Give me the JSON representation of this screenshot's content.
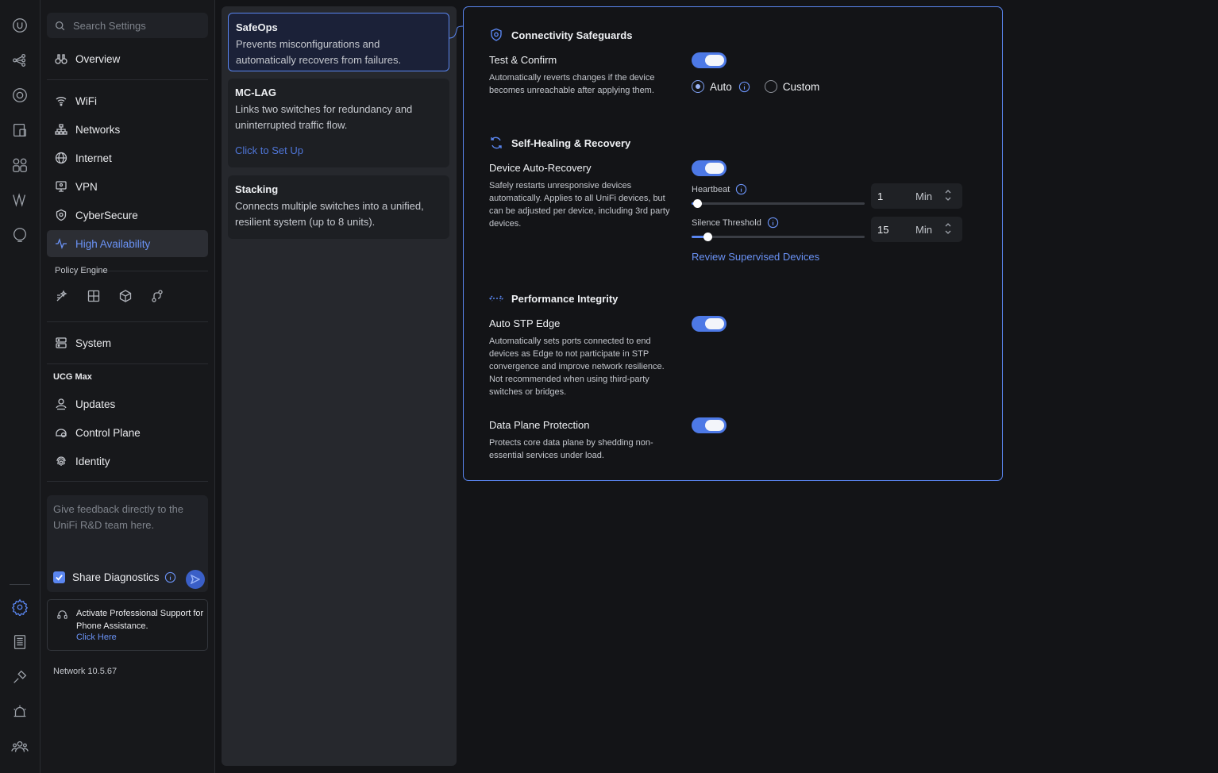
{
  "search": {
    "placeholder": "Search Settings"
  },
  "nav": {
    "overview": "Overview",
    "wifi": "WiFi",
    "networks": "Networks",
    "internet": "Internet",
    "vpn": "VPN",
    "cybersecure": "CyberSecure",
    "high_availability": "High Availability",
    "policy_engine_label": "Policy Engine",
    "system": "System",
    "device_label": "UCG Max",
    "updates": "Updates",
    "control_plane": "Control Plane",
    "identity": "Identity"
  },
  "feedback": {
    "placeholder": "Give feedback directly to the UniFi R&D team here.",
    "share_label": "Share Diagnostics",
    "share_checked": true
  },
  "support": {
    "text": "Activate Professional Support for Phone Assistance.",
    "link": "Click Here"
  },
  "version": "Network 10.5.67",
  "features": [
    {
      "title": "SafeOps",
      "desc": "Prevents misconfigurations and automatically recovers from failures.",
      "selected": true
    },
    {
      "title": "MC-LAG",
      "desc": "Links two switches for redundancy and uninterrupted traffic flow.",
      "action": "Click to Set Up"
    },
    {
      "title": "Stacking",
      "desc": "Connects multiple switches into a unified, resilient system (up to 8 units)."
    }
  ],
  "detail": {
    "connectivity": {
      "heading": "Connectivity Safeguards",
      "test_confirm": {
        "title": "Test & Confirm",
        "desc": "Automatically reverts changes if the device becomes unreachable after applying them.",
        "enabled": true,
        "mode_auto": "Auto",
        "mode_custom": "Custom",
        "selected_mode": "Auto"
      }
    },
    "self_healing": {
      "heading": "Self-Healing & Recovery",
      "auto_recovery": {
        "title": "Device Auto-Recovery",
        "desc": "Safely restarts unresponsive devices automatically. Applies to all UniFi devices, but can be adjusted per device, including 3rd party devices.",
        "enabled": true
      },
      "heartbeat": {
        "label": "Heartbeat",
        "value": "1",
        "unit": "Min",
        "fraction": 0.03
      },
      "silence": {
        "label": "Silence Threshold",
        "value": "15",
        "unit": "Min",
        "fraction": 0.09
      },
      "review_link": "Review Supervised Devices"
    },
    "performance": {
      "heading": "Performance Integrity",
      "stp_edge": {
        "title": "Auto STP Edge",
        "desc": "Automatically sets ports connected to end devices as Edge to not participate in STP convergence and improve network resilience. Not recommended when using third-party switches or bridges.",
        "enabled": true
      },
      "data_plane": {
        "title": "Data Plane Protection",
        "desc": "Protects core data plane by shedding non-essential services under load.",
        "enabled": true
      }
    }
  },
  "colors": {
    "accent": "#5a86f0",
    "toggle_on": "#4d79e6",
    "link": "#6a92f5"
  }
}
